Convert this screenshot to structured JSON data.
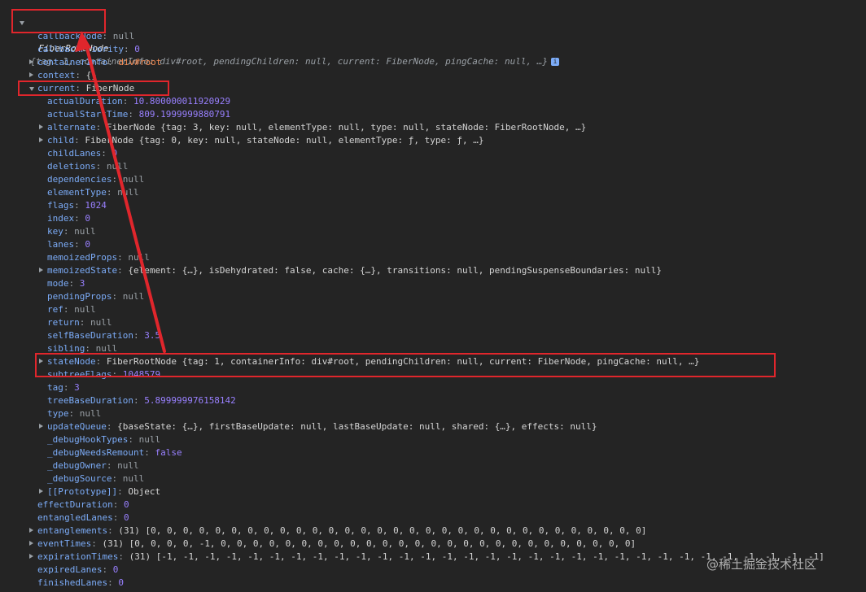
{
  "root": {
    "name": "FiberRootNode",
    "preview": "{tag: 1, containerInfo: div#root, pendingChildren: null, current: FiberNode, pingCache: null, …}",
    "info": "i"
  },
  "rows": {
    "callbackNode": {
      "key": "callbackNode",
      "value": "null"
    },
    "callbackPriority": {
      "key": "callbackPriority",
      "value": "0"
    },
    "containerInfo": {
      "key": "containerInfo",
      "value": "div#root"
    },
    "context": {
      "key": "context",
      "value": "{}"
    },
    "current": {
      "key": "current",
      "value": "FiberNode"
    },
    "actualDuration": {
      "key": "actualDuration",
      "value": "10.800000011920929"
    },
    "actualStartTime": {
      "key": "actualStartTime",
      "value": "809.1999999880791"
    },
    "alternate": {
      "key": "alternate",
      "value": "FiberNode {tag: 3, key: null, elementType: null, type: null, stateNode: FiberRootNode, …}"
    },
    "child": {
      "key": "child",
      "value": "FiberNode {tag: 0, key: null, stateNode: null, elementType: ƒ, type: ƒ, …}"
    },
    "childLanes": {
      "key": "childLanes",
      "value": "0"
    },
    "deletions": {
      "key": "deletions",
      "value": "null"
    },
    "dependencies": {
      "key": "dependencies",
      "value": "null"
    },
    "elementType": {
      "key": "elementType",
      "value": "null"
    },
    "flags": {
      "key": "flags",
      "value": "1024"
    },
    "index": {
      "key": "index",
      "value": "0"
    },
    "key": {
      "key": "key",
      "value": "null"
    },
    "lanes": {
      "key": "lanes",
      "value": "0"
    },
    "memoizedProps": {
      "key": "memoizedProps",
      "value": "null"
    },
    "memoizedState": {
      "key": "memoizedState",
      "value": "{element: {…}, isDehydrated: false, cache: {…}, transitions: null, pendingSuspenseBoundaries: null}"
    },
    "mode": {
      "key": "mode",
      "value": "3"
    },
    "pendingProps": {
      "key": "pendingProps",
      "value": "null"
    },
    "ref": {
      "key": "ref",
      "value": "null"
    },
    "return": {
      "key": "return",
      "value": "null"
    },
    "selfBaseDuration": {
      "key": "selfBaseDuration",
      "value": "3.5"
    },
    "sibling": {
      "key": "sibling",
      "value": "null"
    },
    "stateNode": {
      "key": "stateNode",
      "value": "FiberRootNode {tag: 1, containerInfo: div#root, pendingChildren: null, current: FiberNode, pingCache: null, …}"
    },
    "subtreeFlags": {
      "key": "subtreeFlags",
      "value": "1048579"
    },
    "tag": {
      "key": "tag",
      "value": "3"
    },
    "treeBaseDuration": {
      "key": "treeBaseDuration",
      "value": "5.899999976158142"
    },
    "type": {
      "key": "type",
      "value": "null"
    },
    "updateQueue": {
      "key": "updateQueue",
      "value": "{baseState: {…}, firstBaseUpdate: null, lastBaseUpdate: null, shared: {…}, effects: null}"
    },
    "debugHookTypes": {
      "key": "_debugHookTypes",
      "value": "null"
    },
    "debugNeedsRemount": {
      "key": "_debugNeedsRemount",
      "value": "false"
    },
    "debugOwner": {
      "key": "_debugOwner",
      "value": "null"
    },
    "debugSource": {
      "key": "_debugSource",
      "value": "null"
    },
    "prototype": {
      "key": "[[Prototype]]",
      "value": "Object"
    },
    "effectDuration": {
      "key": "effectDuration",
      "value": "0"
    },
    "entangledLanes": {
      "key": "entangledLanes",
      "value": "0"
    },
    "entanglements": {
      "key": "entanglements",
      "value": "(31) [0, 0, 0, 0, 0, 0, 0, 0, 0, 0, 0, 0, 0, 0, 0, 0, 0, 0, 0, 0, 0, 0, 0, 0, 0, 0, 0, 0, 0, 0, 0]"
    },
    "eventTimes": {
      "key": "eventTimes",
      "value": "(31) [0, 0, 0, 0, -1, 0, 0, 0, 0, 0, 0, 0, 0, 0, 0, 0, 0, 0, 0, 0, 0, 0, 0, 0, 0, 0, 0, 0, 0, 0, 0]"
    },
    "expirationTimes": {
      "key": "expirationTimes",
      "value": "(31) [-1, -1, -1, -1, -1, -1, -1, -1, -1, -1, -1, -1, -1, -1, -1, -1, -1, -1, -1, -1, -1, -1, -1, -1, -1, -1, -1, -1, -1, -1, -1]"
    },
    "expiredLanes": {
      "key": "expiredLanes",
      "value": "0"
    },
    "finishedLanes": {
      "key": "finishedLanes",
      "value": "0"
    }
  },
  "watermark": "@稀土掘金技术社区",
  "colors": {
    "annotation": "#e0262c",
    "key": "#7cacf8",
    "number": "#9980ff",
    "string": "#f28b54",
    "null": "#9aa0a6",
    "background": "#242424"
  }
}
